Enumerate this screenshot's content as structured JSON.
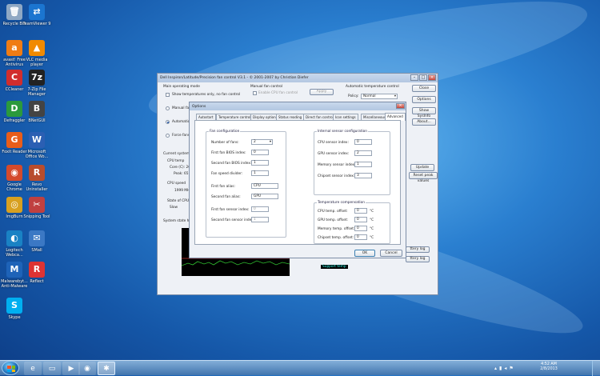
{
  "desktop_icons": [
    {
      "label": "Recycle Bin",
      "icon": "recycle-bin-icon",
      "glyph": "🗑",
      "color": "#8fa8c4"
    },
    {
      "label": "TeamViewer 9",
      "icon": "teamviewer-icon",
      "glyph": "⇄",
      "color": "#1b75d0"
    },
    {
      "label": "avast! Free Antivirus",
      "icon": "avast-icon",
      "glyph": "a",
      "color": "#f07c14"
    },
    {
      "label": "VLC media player",
      "icon": "vlc-icon",
      "glyph": "▲",
      "color": "#f18a00"
    },
    {
      "label": "CCleaner",
      "icon": "ccleaner-icon",
      "glyph": "C",
      "color": "#d12d2d"
    },
    {
      "label": "7-Zip File Manager",
      "icon": "7zip-icon",
      "glyph": "7z",
      "color": "#222"
    },
    {
      "label": "Defraggler",
      "icon": "defraggler-icon",
      "glyph": "D",
      "color": "#2b9a3c"
    },
    {
      "label": "BNetGUI",
      "icon": "bnetgui-icon",
      "glyph": "B",
      "color": "#444"
    },
    {
      "label": "Foxit Reader",
      "icon": "foxit-icon",
      "glyph": "G",
      "color": "#e85d1a"
    },
    {
      "label": "Microsoft Office Wo...",
      "icon": "word-icon",
      "glyph": "W",
      "color": "#2b5fb3"
    },
    {
      "label": "Google Chrome",
      "icon": "chrome-icon",
      "glyph": "◉",
      "color": "#d44a2c"
    },
    {
      "label": "Revo Uninstaller",
      "icon": "revo-icon",
      "glyph": "R",
      "color": "#b84d2d"
    },
    {
      "label": "ImgBurn",
      "icon": "imgburn-icon",
      "glyph": "◎",
      "color": "#d8a020"
    },
    {
      "label": "Snipping Tool",
      "icon": "snipping-tool-icon",
      "glyph": "✂",
      "color": "#c04040"
    },
    {
      "label": "Logitech Webca...",
      "icon": "webcam-icon",
      "glyph": "◐",
      "color": "#1a82c4"
    },
    {
      "label": "SMall",
      "icon": "smail-icon",
      "glyph": "✉",
      "color": "#3b78c4"
    },
    {
      "label": "Malwarebyt... Anti-Malware",
      "icon": "malwarebytes-icon",
      "glyph": "M",
      "color": "#1e63b8"
    },
    {
      "label": "Reflect",
      "icon": "reflect-icon",
      "glyph": "R",
      "color": "#d33"
    },
    {
      "label": "Skype",
      "icon": "skype-icon",
      "glyph": "S",
      "color": "#00aff0"
    }
  ],
  "main_window": {
    "title": "Dell Inspiron/Latitude/Precision fan control V3.1 - © 2001-2007 by Christian Diefer",
    "main_mode_label": "Main operating mode",
    "mode_options": [
      "Show temperatures only, no fan control",
      "Manual fan c",
      "Automatic fa",
      "Force fans t"
    ],
    "manual_fan_label": "Manual fan control",
    "enable_cpu_fan": "Enable CPU fan control",
    "apply": "Apply",
    "auto_temp_label": "Automatic temperature control",
    "policy_label": "Policy:",
    "policy_value": "Normal",
    "buttons": {
      "close": "Close",
      "options": "Options",
      "show_sysinfo": "Show SysInfo",
      "about": "About...",
      "update": "Update",
      "reset_peak": "Reset peak values",
      "battery_log_1": "ttery log",
      "battery_log_2": "ttery log"
    },
    "current_state_label": "Current system st",
    "cpu_temp_label": "CPU temp",
    "core_label": "Core (C): 26 / 2",
    "peak_label": "Peak: 65 °C",
    "cpu_speed_label": "CPU speed",
    "cpu_speed_value": "1999 MHz",
    "state_of_cpu_fan": "State of CPU fan",
    "slow": "Slow",
    "history_label": "System state histo",
    "support_label": "Support temp"
  },
  "options_dialog": {
    "title": "Options",
    "tabs": [
      "Autostart",
      "Temperature control",
      "Display options",
      "Status reading",
      "Direct fan control",
      "Icon settings",
      "Miscellaneous",
      "Advanced"
    ],
    "active_tab": "Advanced",
    "fan_config": {
      "title": "Fan configuration",
      "num_fans_label": "Number of fans:",
      "num_fans_value": "2",
      "first_bios_label": "First fan BIOS index:",
      "first_bios_value": "0",
      "second_bios_label": "Second fan BIOS index:",
      "second_bios_value": "1",
      "divider_label": "Fan speed divider:",
      "divider_value": "1",
      "first_alias_label": "First fan alias:",
      "first_alias_value": "CPU",
      "second_alias_label": "Second fan alias:",
      "second_alias_value": "GPU",
      "first_sensor_label": "First fan sensor index:",
      "first_sensor_value": "0",
      "second_sensor_label": "Second fan sensor index:",
      "second_sensor_value": "1"
    },
    "sensor_config": {
      "title": "Internal sensor configuration",
      "cpu_label": "CPU sensor index:",
      "cpu_value": "0",
      "gpu_label": "GPU sensor index:",
      "gpu_value": "2",
      "memory_label": "Memory sensor index:",
      "memory_value": "1",
      "chipset_label": "Chipset sensor index:",
      "chipset_value": "3"
    },
    "temp_comp": {
      "title": "Temperature compensation",
      "cpu_label": "CPU temp. offset:",
      "cpu_value": "0",
      "gpu_label": "GPU temp. offset:",
      "gpu_value": "0",
      "memory_label": "Memory temp. offset:",
      "memory_value": "0",
      "chipset_label": "Chipset temp. offset:",
      "chipset_value": "0",
      "unit": "°C"
    },
    "ok": "OK",
    "cancel": "Cancel"
  },
  "taskbar": {
    "time": "4:52 AM",
    "date": "2/8/2013"
  }
}
